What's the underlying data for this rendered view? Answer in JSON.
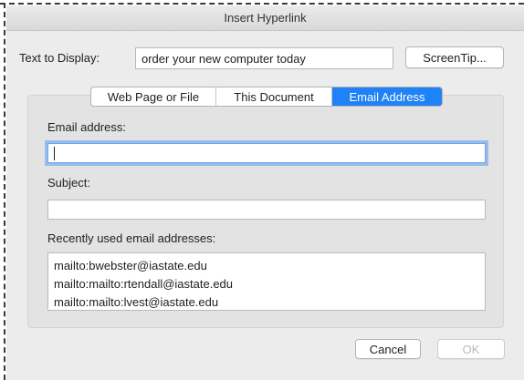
{
  "window": {
    "title": "Insert Hyperlink"
  },
  "display": {
    "label": "Text to Display:",
    "value": "order your new computer today",
    "screentip_label": "ScreenTip..."
  },
  "tabs": [
    {
      "label": "Web Page or File",
      "active": false
    },
    {
      "label": "This Document",
      "active": false
    },
    {
      "label": "Email Address",
      "active": true
    }
  ],
  "email": {
    "address_label": "Email address:",
    "address_value": "",
    "subject_label": "Subject:",
    "subject_value": "",
    "recent_label": "Recently used email addresses:",
    "recent": [
      "mailto:bwebster@iastate.edu",
      "mailto:mailto:rtendall@iastate.edu",
      "mailto:mailto:lvest@iastate.edu"
    ]
  },
  "footer": {
    "cancel_label": "Cancel",
    "ok_label": "OK",
    "ok_enabled": false
  },
  "colors": {
    "accent": "#1f82f7",
    "dialog_bg": "#ececec",
    "panel_bg": "#e3e3e3"
  }
}
